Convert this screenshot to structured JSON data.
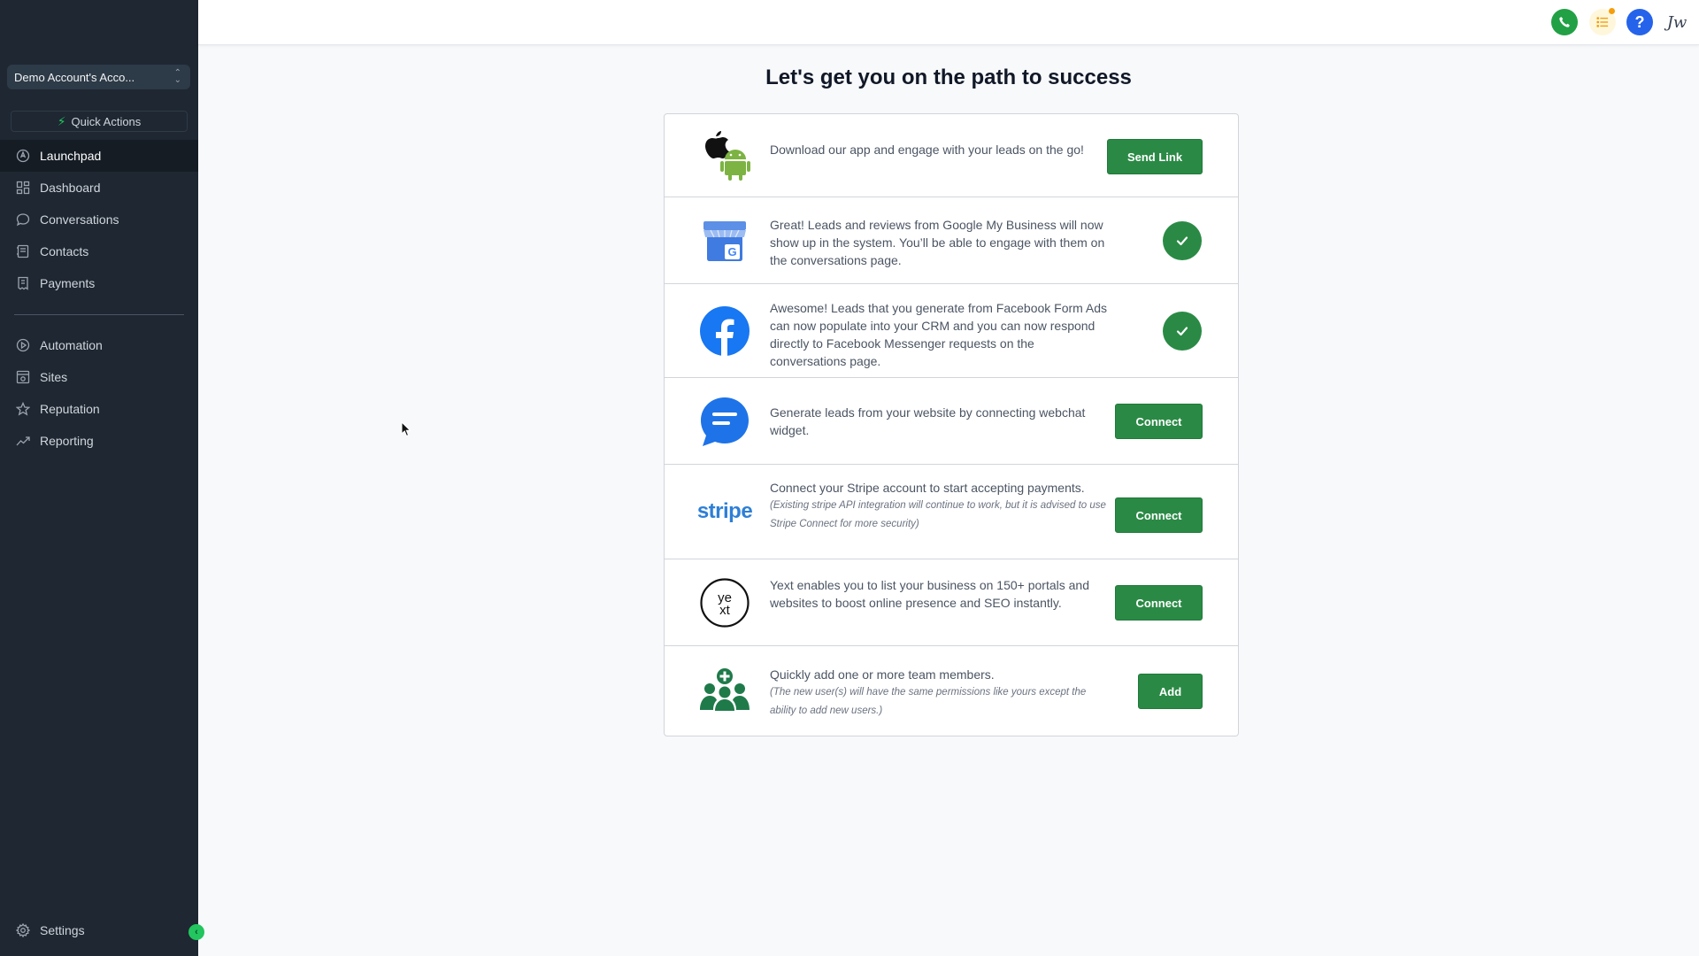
{
  "sidebar": {
    "account_name": "Demo Account's Acco...",
    "quick_actions": "Quick Actions",
    "nav_top": [
      {
        "label": "Launchpad",
        "icon": "rocket-icon"
      },
      {
        "label": "Dashboard",
        "icon": "grid-icon"
      },
      {
        "label": "Conversations",
        "icon": "chat-icon"
      },
      {
        "label": "Contacts",
        "icon": "contacts-icon"
      },
      {
        "label": "Payments",
        "icon": "payments-icon"
      }
    ],
    "nav_bottom": [
      {
        "label": "Automation",
        "icon": "automation-icon"
      },
      {
        "label": "Sites",
        "icon": "sites-icon"
      },
      {
        "label": "Reputation",
        "icon": "star-icon"
      },
      {
        "label": "Reporting",
        "icon": "trend-icon"
      }
    ],
    "settings": "Settings",
    "active": "Launchpad"
  },
  "topbar": {
    "help_glyph": "?",
    "signature": "Jw"
  },
  "main": {
    "title": "Let's get you on the path to success",
    "rows": [
      {
        "text": "Download our app and engage with your leads on the go!",
        "action": "Send Link",
        "icon": "apple-android-icon"
      },
      {
        "text": "Great! Leads and reviews from Google My Business will now show up in the system. You’ll be able to engage with them on the conversations page.",
        "status": "connected",
        "icon": "google-my-business-icon"
      },
      {
        "text": "Awesome! Leads that you generate from Facebook Form Ads can now populate into your CRM and you can now respond directly to Facebook Messenger requests on the conversations page.",
        "status": "connected",
        "icon": "facebook-icon"
      },
      {
        "text": "Generate leads from your website by connecting webchat widget.",
        "action": "Connect",
        "icon": "webchat-icon"
      },
      {
        "text": "Connect your Stripe account to start accepting payments.",
        "note": "(Existing stripe API integration will continue to work, but it is advised to use Stripe Connect for more security)",
        "action": "Connect",
        "icon": "stripe-icon",
        "logo_text": "stripe"
      },
      {
        "text": "Yext enables you to list your business on 150+ portals and websites to boost online presence and SEO instantly.",
        "action": "Connect",
        "icon": "yext-icon",
        "logo_text": "ye xt"
      },
      {
        "text": "Quickly add one or more team members.",
        "note": "(The new user(s) will have the same permissions like yours except the ability to add new users.)",
        "action": "Add",
        "icon": "team-add-icon"
      }
    ]
  },
  "colors": {
    "sidebar_bg": "#1e2732",
    "accent_green": "#2a8a45",
    "help_blue": "#2563eb",
    "facebook_blue": "#1877f2"
  }
}
